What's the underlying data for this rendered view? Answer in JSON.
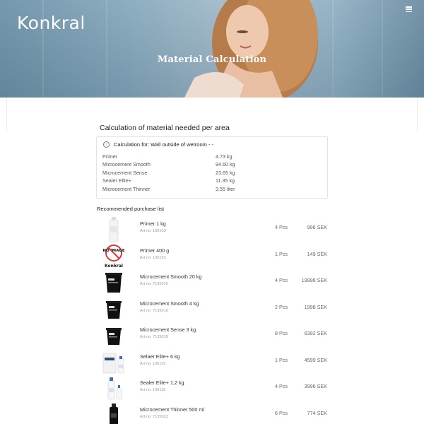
{
  "header": {
    "logo": "Konkral",
    "title": "Material Calculation"
  },
  "calculation": {
    "section_title": "Calculation of material needed per area",
    "for_label": "Calculation for: Wall outside of wetroom - -",
    "rows": [
      {
        "name": "Primer",
        "amount": "4.73 kg"
      },
      {
        "name": "Microcement Smooth",
        "amount": "94.60 kg"
      },
      {
        "name": "Microcement Sense",
        "amount": "23.65 kg"
      },
      {
        "name": "Sealer Elite+",
        "amount": "11.35 kg"
      },
      {
        "name": "Microcement Thinner",
        "amount": "3.55 liter"
      }
    ]
  },
  "purchase_list": {
    "title": "Recommended purchase list",
    "no_image_text": "NO IMAGE",
    "no_image_brand": "Konkral",
    "products": [
      {
        "name": "Primer 1 kg",
        "art": "Art no: 100103",
        "qty": "4 Pcs",
        "price": "996 SEK",
        "thumb": "bottle-white"
      },
      {
        "name": "Primer 400 g",
        "art": "Art no: 100153",
        "qty": "1 Pcs",
        "price": "149 SEK",
        "thumb": "no-image"
      },
      {
        "name": "Microcement Smooth 20 kg",
        "art": "Art no: 7135015",
        "qty": "4 Pcs",
        "price": "19996 SEK",
        "thumb": "bucket-black"
      },
      {
        "name": "Microcement Smooth 4 kg",
        "art": "Art no: 7135016",
        "qty": "2 Pcs",
        "price": "1998 SEK",
        "thumb": "bucket-black"
      },
      {
        "name": "Microcement Sense 3 kg",
        "art": "Art no: 7135018",
        "qty": "8 Pcs",
        "price": "6392 SEK",
        "thumb": "bucket-black"
      },
      {
        "name": "Selaer Elite+ 6 kg",
        "art": "Art no: 100119",
        "qty": "1 Pcs",
        "price": "4599 SEK",
        "thumb": "sealer-kit"
      },
      {
        "name": "Sealer Elite+ 1,2 kg",
        "art": "Art no: 100118",
        "qty": "4 Pcs",
        "price": "3996 SEK",
        "thumb": "sealer-small"
      },
      {
        "name": "Microcement Thinner 500 ml",
        "art": "Art no: 7135023",
        "qty": "6 Pcs",
        "price": "774 SEK",
        "thumb": "bottle-black"
      }
    ]
  }
}
